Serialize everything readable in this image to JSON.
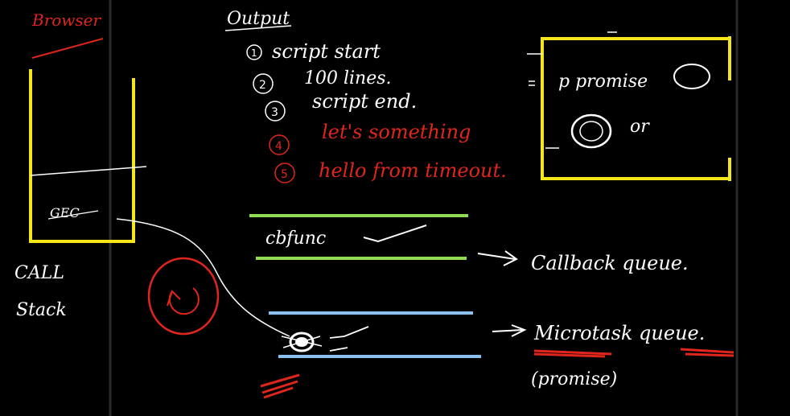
{
  "colors": {
    "background": "#000000",
    "ink_white": "#ffffff",
    "ink_red": "#e0261c",
    "frame_yellow": "#f5e61a",
    "line_green": "#8fdd55",
    "line_blue": "#8cc1ef",
    "panel_border": "#2a2a2a"
  },
  "browser_label": "Browser",
  "call_stack": {
    "frame_label": "GEC",
    "label_line1": "CALL",
    "label_line2": "Stack"
  },
  "output": {
    "title": "Output",
    "items": [
      {
        "num": "1",
        "text": "script start",
        "color": "white"
      },
      {
        "num": "2",
        "text": "100 lines.",
        "color": "white"
      },
      {
        "num": "3",
        "text": "script end.",
        "color": "white"
      },
      {
        "num": "4",
        "text": "let's something",
        "color": "red"
      },
      {
        "num": "5",
        "text": "hello from timeout.",
        "color": "red"
      }
    ]
  },
  "promise_box": {
    "line1": "p promise",
    "line2": "or"
  },
  "callback_queue": {
    "item": "cbfunc",
    "label": "Callback queue."
  },
  "microtask_queue": {
    "label": "Microtask queue.",
    "sub": "(promise)"
  }
}
